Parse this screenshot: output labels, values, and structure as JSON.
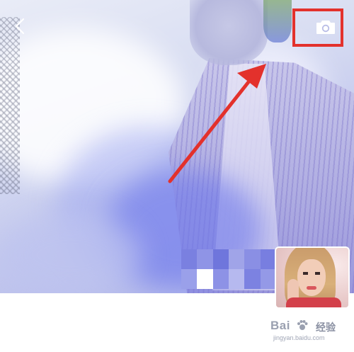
{
  "header": {
    "back_icon": "chevron-left-icon",
    "camera_icon": "camera-icon"
  },
  "annotation": {
    "highlight_color": "#e3312c",
    "arrow_color": "#e3312c"
  },
  "watermark": {
    "brand": "Bai",
    "suffix": "经验",
    "url": "jingyan.baidu.com"
  }
}
